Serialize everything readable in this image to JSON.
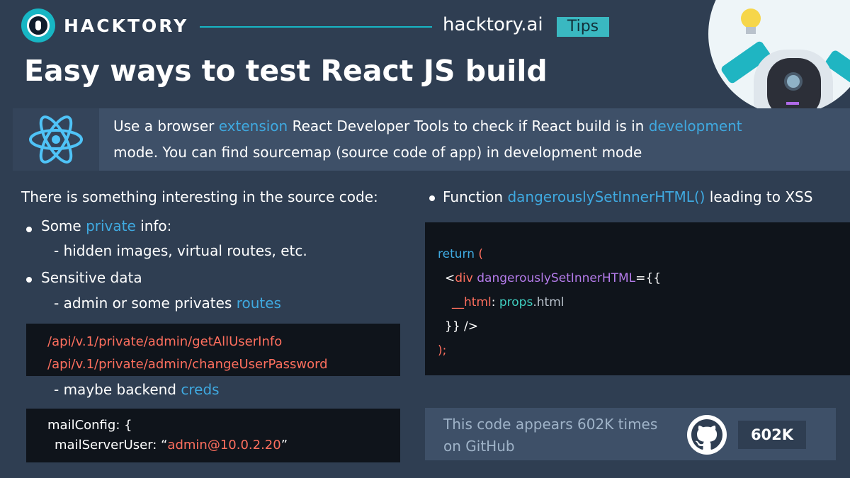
{
  "header": {
    "brand": "HACKTORY",
    "site": "hacktory.ai",
    "badge": "Tips",
    "title": "Easy ways to test React JS build"
  },
  "banner": {
    "icon": "react-logo-icon",
    "text_part1": "Use a browser ",
    "text_accent1": "extension",
    "text_part2": " React Developer Tools to check if React build is in ",
    "text_accent2": "development",
    "text_part3": "mode. You can find sourcemap (source code of app) in development mode"
  },
  "left": {
    "intro": "There is something interesting in the source code:",
    "bullet1_prefix": "Some ",
    "bullet1_accent": "private",
    "bullet1_suffix": " info:",
    "sub1": "- hidden images, virtual routes, etc.",
    "bullet2": "Sensitive data",
    "sub2_prefix": "- admin or some privates ",
    "sub2_accent": "routes",
    "routes": [
      "/api/v.1/private/admin/getAllUserInfo",
      "/api/v.1/private/admin/changeUserPassword"
    ],
    "sub3_prefix": "- maybe backend ",
    "sub3_accent": "creds",
    "mail_line1": "mailConfig: {",
    "mail_line2_key": "mailServerUser: “",
    "mail_line2_value": "admin@10.0.2.20",
    "mail_line2_end": "”"
  },
  "right": {
    "fn_prefix": "Function ",
    "fn_accent": "dangerouslySetInnerHTML()",
    "fn_suffix": " leading to XSS",
    "code": {
      "l1_kw": "return",
      "l1_paren": " (",
      "l2_open": "<",
      "l2_tag": "div",
      "l2_attr": " dangerouslySetInnerHTML",
      "l2_end": "={{",
      "l3_prop": "__html",
      "l3_colon": ": ",
      "l3_obj": "props",
      "l3_dim": ".html",
      "l4": "}} />",
      "l5": ");"
    },
    "github": {
      "line1": "This code appears 602K times",
      "line2": "on GitHub",
      "icon": "github-icon",
      "count": "602K"
    }
  },
  "colors": {
    "background": "#2f3e52",
    "accent": "#3fa9e0",
    "teal": "#17b6c4",
    "code_red": "#ff6f5e"
  }
}
